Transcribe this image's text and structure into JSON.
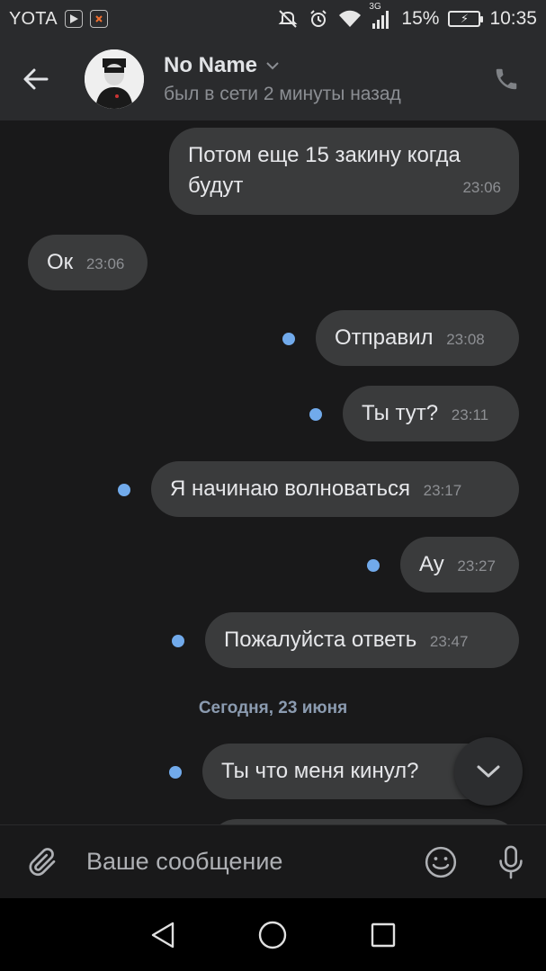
{
  "status_bar": {
    "carrier": "YOTA",
    "signal_type": "3G",
    "battery": "15%",
    "time": "10:35",
    "icons": [
      "play-store-icon",
      "app-notification-icon",
      "mute-icon",
      "alarm-icon",
      "wifi-icon",
      "signal-icon",
      "battery-charging-icon"
    ]
  },
  "header": {
    "name": "No Name",
    "status": "был в сети 2 минуты назад",
    "back_icon": "arrow-left-icon",
    "call_icon": "phone-icon"
  },
  "messages": [
    {
      "text_line1": "Потом еще 15 закину когда",
      "text_line2": "будут",
      "time": "23:06",
      "outgoing": true
    },
    {
      "text": "Ок",
      "time": "23:06",
      "outgoing": false
    },
    {
      "text": "Отправил",
      "time": "23:08",
      "outgoing": true,
      "unread": true
    },
    {
      "text": "Ты тут?",
      "time": "23:11",
      "outgoing": true,
      "unread": true
    },
    {
      "text": "Я начинаю волноваться",
      "time": "23:17",
      "outgoing": true,
      "unread": true
    },
    {
      "text": "Ау",
      "time": "23:27",
      "outgoing": true,
      "unread": true
    },
    {
      "text": "Пожалуйста ответь",
      "time": "23:47",
      "outgoing": true,
      "unread": true
    },
    {
      "text": "Ты что меня кинул?",
      "outgoing": true,
      "unread": true
    }
  ],
  "date_separator": "Сегодня, 23 июня",
  "composer": {
    "placeholder": "Ваше сообщение",
    "attach_icon": "paperclip-icon",
    "emoji_icon": "smile-icon",
    "mic_icon": "microphone-icon"
  },
  "colors": {
    "background": "#19191a",
    "header": "#2a2b2d",
    "bubble": "#3a3b3c",
    "unread_dot": "#71aaeb",
    "date_text": "#8b9bb0"
  }
}
